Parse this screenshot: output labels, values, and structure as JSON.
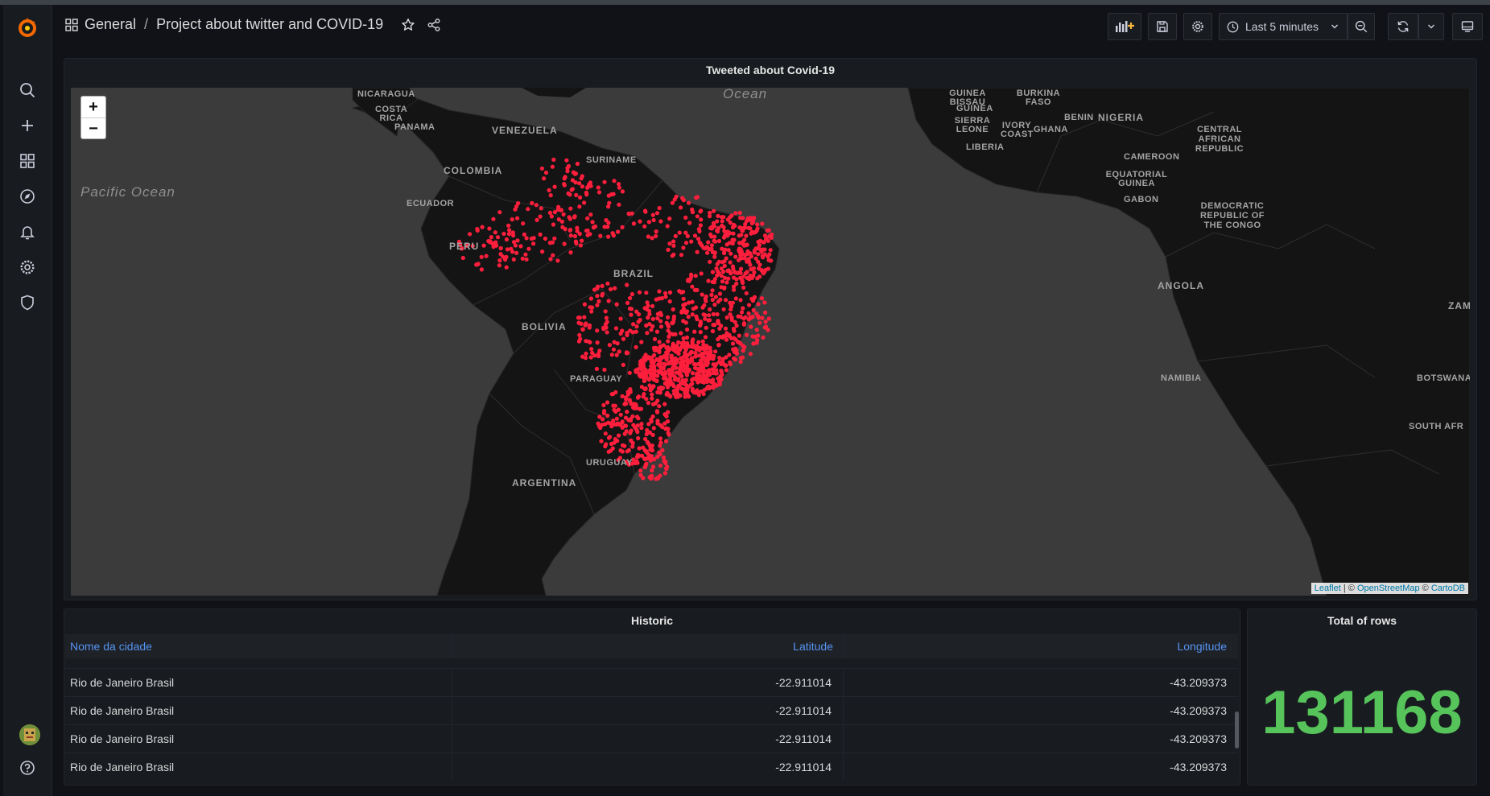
{
  "breadcrumb": {
    "folder": "General",
    "separator": "/",
    "dashboard": "Project about twitter and COVID-19"
  },
  "toolbar": {
    "time_range": "Last 5 minutes"
  },
  "map_panel": {
    "title": "Tweeted about Covid-19",
    "zoom_in": "+",
    "zoom_out": "−",
    "attribution": {
      "leaflet": "Leaflet",
      "sep1": " | © ",
      "osm": "OpenStreetMap",
      "sep2": " © ",
      "carto": "CartoDB"
    },
    "labels": {
      "pacific": "Pacific Ocean",
      "atlantic": "Ocean",
      "nicaragua": "NICARAGUA",
      "costa_rica": "COSTA RICA",
      "panama": "PANAMA",
      "venezuela": "VENEZUELA",
      "colombia": "COLOMBIA",
      "suriname": "SURINAME",
      "ecuador": "ECUADOR",
      "peru": "PERU",
      "brazil": "BRAZIL",
      "bolivia": "BOLIVIA",
      "paraguay": "PARAGUAY",
      "uruguay": "URUGUAY",
      "argentina": "ARGENTINA",
      "guinea_bissau": "GUINEA BISSAU",
      "guinea": "GUINEA",
      "sierra_leone": "SIERRA LEONE",
      "liberia": "LIBERIA",
      "ivory_coast": "IVORY COAST",
      "ghana": "GHANA",
      "burkina_faso": "BURKINA FASO",
      "benin": "BENIN",
      "nigeria": "NIGERIA",
      "car": "CENTRAL AFRICAN REPUBLIC",
      "cameroon": "CAMEROON",
      "eq_guinea": "EQUATORIAL GUINEA",
      "gabon": "GABON",
      "drc": "DEMOCRATIC REPUBLIC OF THE CONGO",
      "angola": "ANGOLA",
      "zambia": "ZAM",
      "namibia": "NAMIBIA",
      "botswana": "BOTSWANA",
      "south_africa": "SOUTH AFR"
    }
  },
  "historic_panel": {
    "title": "Historic",
    "columns": [
      "Nome da cidade",
      "Latitude",
      "Longitude"
    ],
    "rows": [
      [
        "Rio de Janeiro Brasil",
        "-22.911014",
        "-43.209373"
      ],
      [
        "Rio de Janeiro Brasil",
        "-22.911014",
        "-43.209373"
      ],
      [
        "Rio de Janeiro Brasil",
        "-22.911014",
        "-43.209373"
      ],
      [
        "Rio de Janeiro Brasil",
        "-22.911014",
        "-43.209373"
      ]
    ]
  },
  "total_panel": {
    "title": "Total of rows",
    "value": "131168"
  },
  "colors": {
    "accent": "#5794f2",
    "stat_green": "#56c45a",
    "marker_red": "#ff1f3d"
  }
}
